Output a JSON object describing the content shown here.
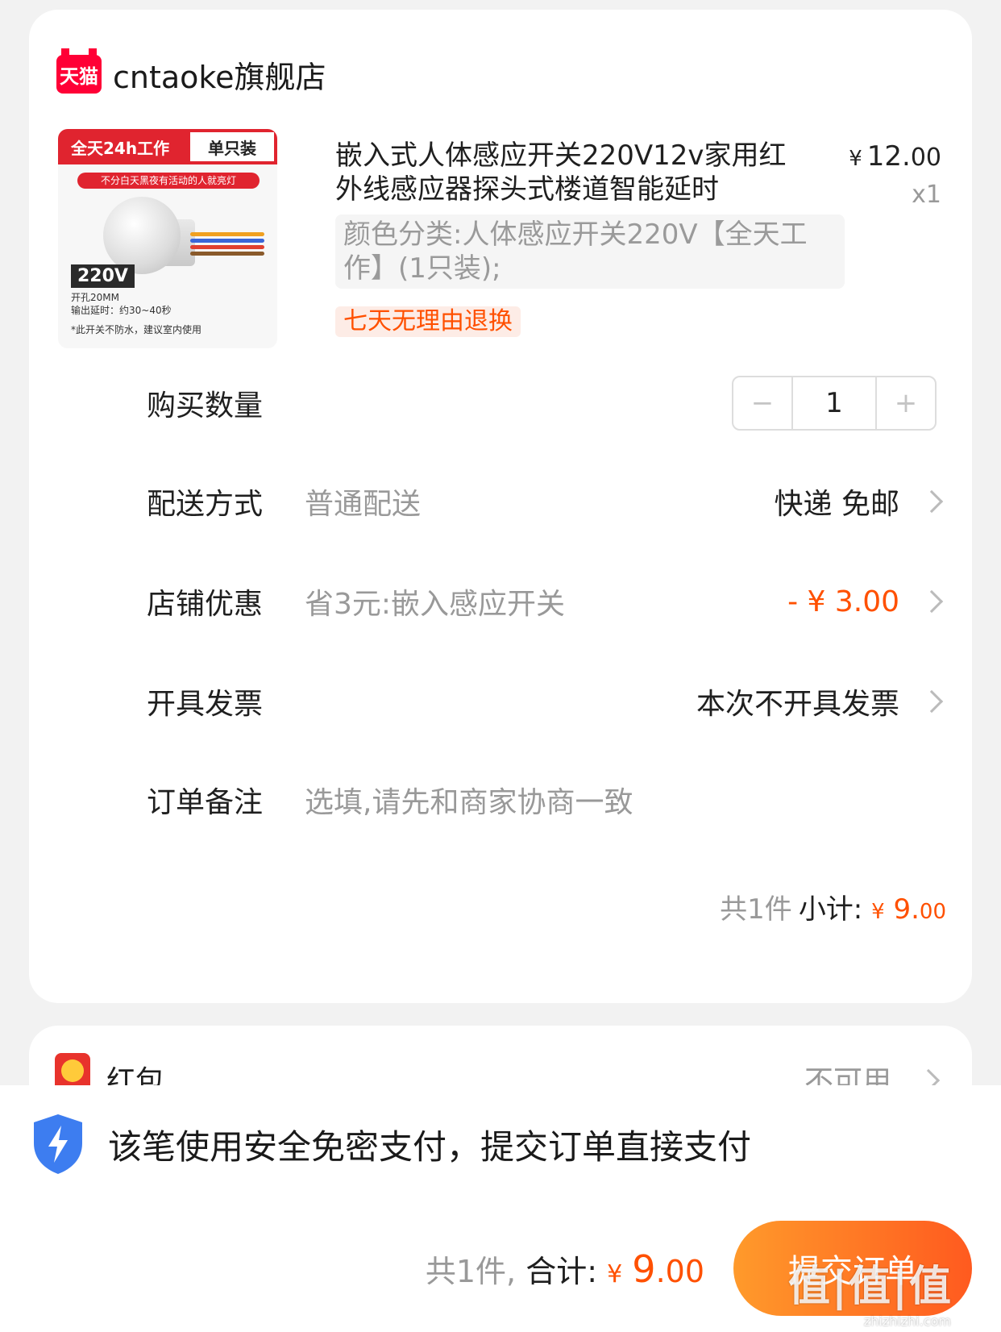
{
  "shop": {
    "badge": "天猫",
    "name": "cntaoke旗舰店"
  },
  "product": {
    "image": {
      "banner_left": "全天24h工作",
      "banner_right": "单只装",
      "subline": "不分白天黑夜有活动的人就亮灯",
      "voltage": "220V",
      "spec1": "开孔20MM",
      "spec2": "输出延时：约30~40秒",
      "spec3": "*此开关不防水，建议室内使用"
    },
    "title": "嵌入式人体感应开关220V12v家用红外线感应器探头式楼道智能延时",
    "price_yen": "¥",
    "price_int": "12.",
    "price_cents": "00",
    "quantity_label": "x1",
    "sku": "颜色分类:人体感应开关220V【全天工作】(1只装);",
    "tag": "七天无理由退换"
  },
  "rows": {
    "quantity": {
      "label": "购买数量",
      "minus": "−",
      "value": "1",
      "plus": "+"
    },
    "delivery": {
      "label": "配送方式",
      "hint": "普通配送",
      "value": "快递 免邮"
    },
    "discount": {
      "label": "店铺优惠",
      "hint": "省3元:嵌入感应开关",
      "value": "- ¥ 3.00"
    },
    "invoice": {
      "label": "开具发票",
      "value": "本次不开具发票"
    },
    "note": {
      "label": "订单备注",
      "placeholder": "选填,请先和商家协商一致"
    }
  },
  "subtotal": {
    "count": "共1件",
    "label": "小计:",
    "yen": "¥",
    "int": "9.",
    "cents": "00"
  },
  "redpacket": {
    "label": "红包",
    "value": "不可用"
  },
  "bottom": {
    "secure_text": "该笔使用安全免密支付，提交订单直接支付",
    "count": "共1件,",
    "total_label": "合计:",
    "yen": "¥",
    "int": "9",
    "cents": ".00",
    "submit": "提交订单"
  },
  "watermark": {
    "main": "值|值|值",
    "sub": "zhizhizhi.com"
  },
  "colors": {
    "accent": "#ff5000",
    "tmall": "#ff0036",
    "submit_start": "#ff9a2b",
    "submit_end": "#ff5a1f"
  }
}
